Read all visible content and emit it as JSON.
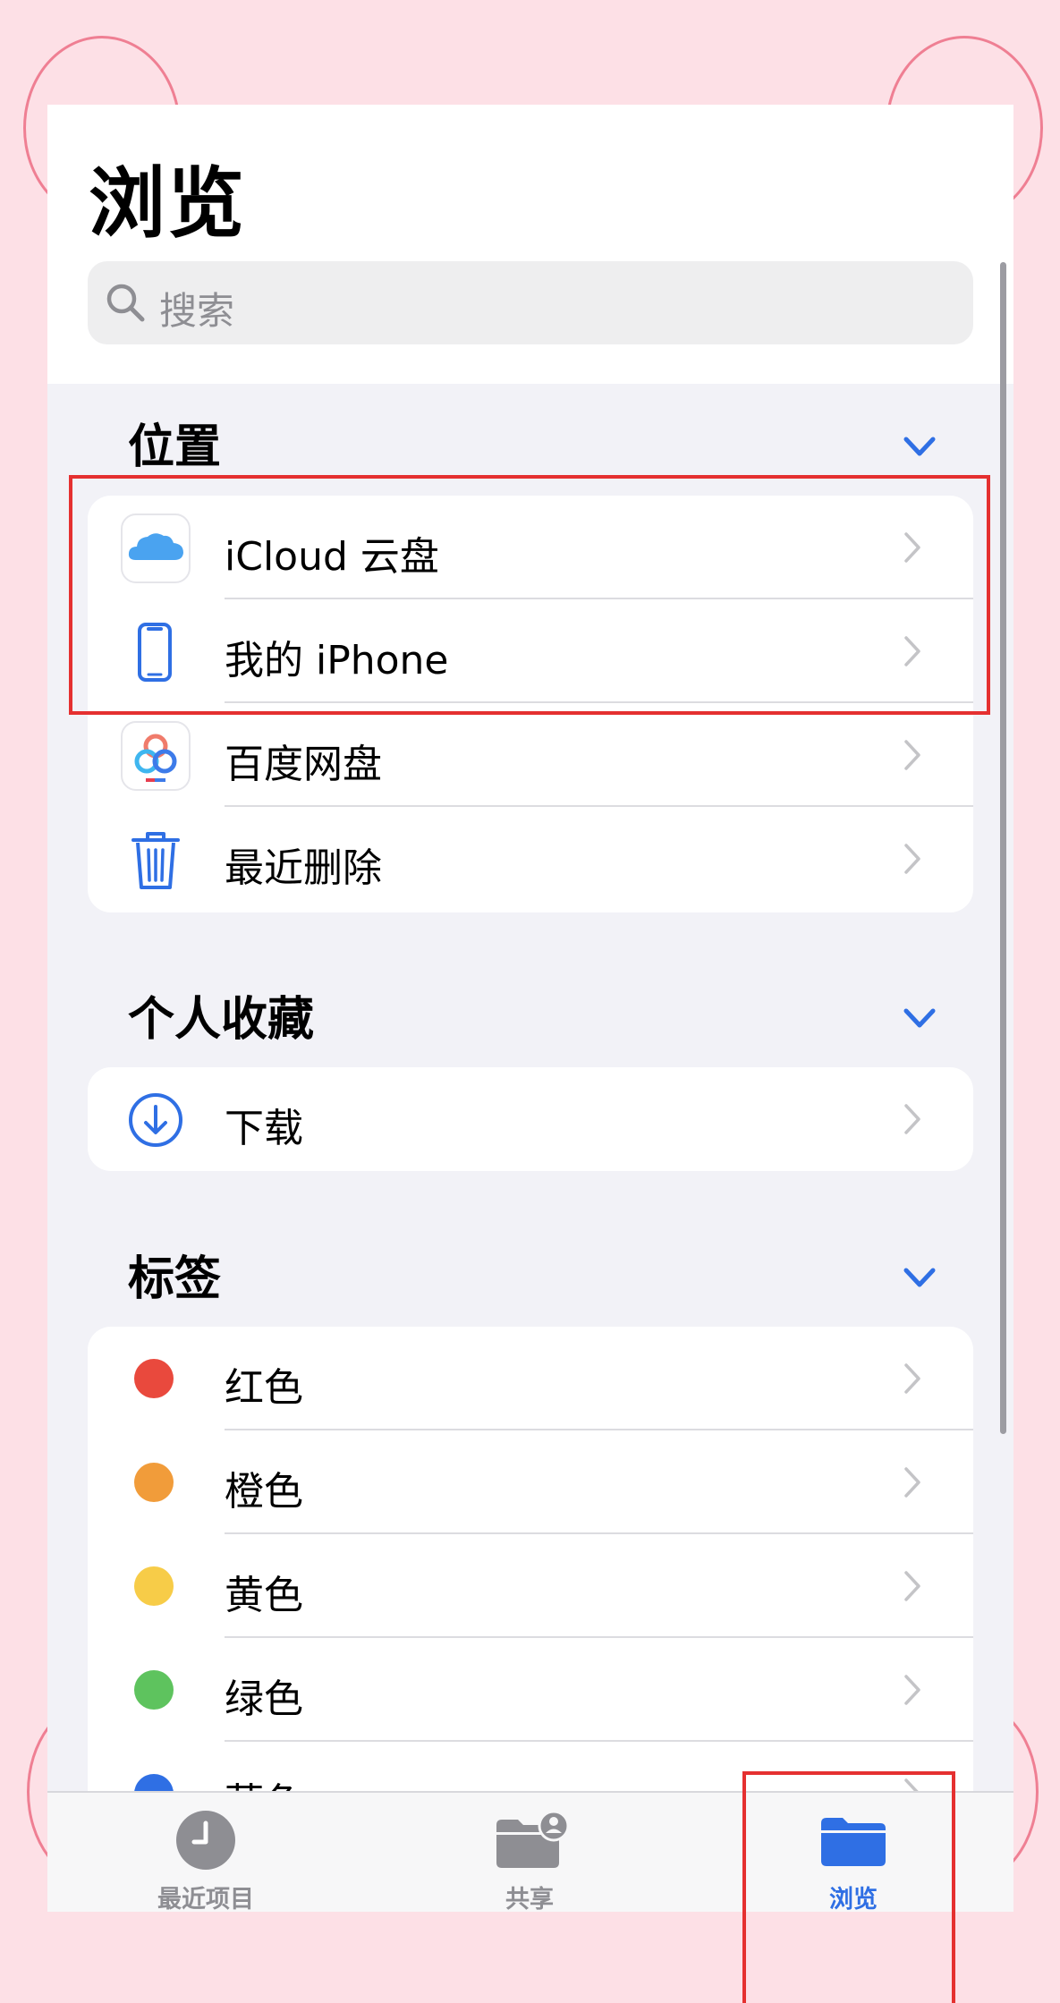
{
  "header": {
    "title": "浏览",
    "search_placeholder": "搜索"
  },
  "sections": {
    "locations": {
      "title": "位置",
      "items": [
        {
          "label": "iCloud 云盘"
        },
        {
          "label": "我的 iPhone"
        },
        {
          "label": "百度网盘"
        },
        {
          "label": "最近删除"
        }
      ]
    },
    "favorites": {
      "title": "个人收藏",
      "items": [
        {
          "label": "下载"
        }
      ]
    },
    "tags": {
      "title": "标签",
      "items": [
        {
          "label": "红色",
          "color": "#e9493d"
        },
        {
          "label": "橙色",
          "color": "#f19c3a"
        },
        {
          "label": "黄色",
          "color": "#f7cc48"
        },
        {
          "label": "绿色",
          "color": "#5ec35e"
        },
        {
          "label": "蓝色",
          "color": "#2f6fe4"
        }
      ]
    }
  },
  "tabbar": {
    "recent": "最近项目",
    "shared": "共享",
    "browse": "浏览"
  },
  "colors": {
    "accent": "#2f6fe4",
    "inactive_tab": "#8e8e93",
    "highlight": "#e53030"
  }
}
